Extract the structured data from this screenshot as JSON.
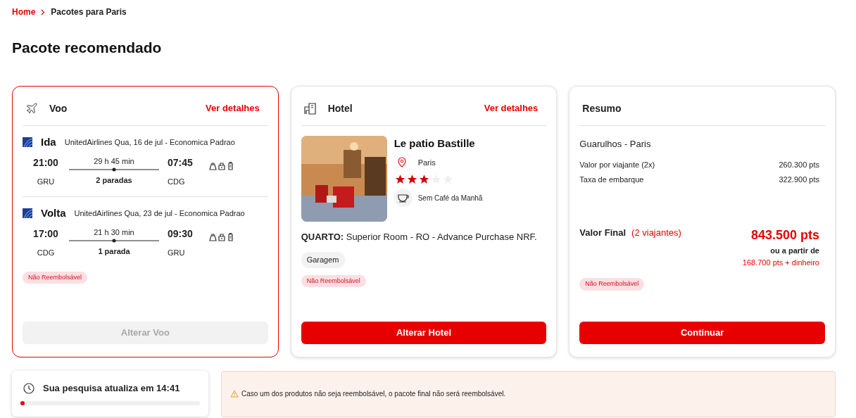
{
  "breadcrumb": [
    {
      "label": "Home",
      "current": false
    },
    {
      "label": "Pacotes para Paris",
      "current": true
    }
  ],
  "title": "Pacote recomendado",
  "flight": {
    "title": "Voo",
    "selected": true,
    "details_link": "Ver detalhes",
    "legs": [
      {
        "label": "Ida",
        "info": "UnitedAirlines Qua, 16 de jul - Economica Padrao",
        "depart_time": "21:00",
        "depart_airport": "GRU",
        "duration": "29 h 45 min",
        "stops": "2 paradas",
        "arrive_time": "07:45",
        "arrive_airport": "CDG"
      },
      {
        "label": "Volta",
        "info": "UnitedAirlines Qua, 23 de jul - Economica Padrao",
        "depart_time": "17:00",
        "depart_airport": "CDG",
        "duration": "21 h 30 min",
        "stops": "1 parada",
        "arrive_time": "09:30",
        "arrive_airport": "GRU"
      }
    ],
    "badge": "Não Reembolsável",
    "button": {
      "label": "Alterar Voo",
      "disabled": true
    }
  },
  "hotel": {
    "title": "Hotel",
    "selected": false,
    "details_link": "Ver detalhes",
    "name": "Le patio Bastille",
    "city": "Paris",
    "stars": 3,
    "meal": "Sem Café da Manhã",
    "room_label": "QUARTO:",
    "room": "Superior Room - RO - Advance Purchase NRF.",
    "amenities": [
      "Garagem"
    ],
    "badge": "Não Reembolsável",
    "button": {
      "label": "Alterar Hotel",
      "disabled": false
    }
  },
  "summary": {
    "title": "Resumo",
    "selected": false,
    "route": "Guarulhos - Paris",
    "lines": [
      {
        "label": "Valor por viajante (2x)",
        "value": "260.300 pts"
      },
      {
        "label": "Taxa de embarque",
        "value": "322.900 pts"
      }
    ],
    "final_label": "Valor Final",
    "travelers": "(2 viajantes)",
    "total": "843.500 pts",
    "alt_label": "ou a partir de",
    "alt_value": "168.700 pts + dinheiro",
    "badge": "Não Reembolsável",
    "button": {
      "label": "Continuar",
      "disabled": false
    }
  },
  "timer": {
    "text": "Sua pesquisa atualiza em 14:41",
    "level": 0.02
  },
  "warning": "Caso um dos produtos não seja reembolsável, o pacote final não será reembolsável."
}
